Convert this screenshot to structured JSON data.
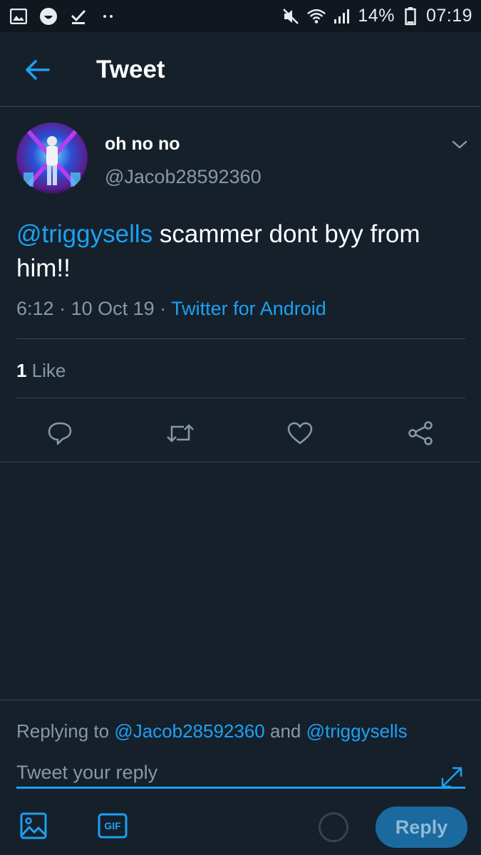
{
  "status_bar": {
    "battery_percent": "14%",
    "time": "07:19"
  },
  "app_bar": {
    "title": "Tweet"
  },
  "tweet": {
    "display_name": "oh no no",
    "handle": "@Jacob28592360",
    "mention": "@triggysells",
    "text": " scammer dont byy from him!!",
    "time": "6:12",
    "date": "10 Oct 19",
    "source": "Twitter for Android",
    "separator": " · ",
    "like_count": "1",
    "like_label": " Like"
  },
  "composer": {
    "replying_prefix": "Replying to ",
    "replying_user1": "@Jacob28592360",
    "replying_and": " and ",
    "replying_user2": "@triggysells",
    "placeholder": "Tweet your reply",
    "gif_label": "GIF",
    "reply_label": "Reply"
  },
  "colors": {
    "background": "#15202b",
    "accent": "#1da1f2",
    "muted": "#8899a6",
    "divider": "#38444d"
  }
}
